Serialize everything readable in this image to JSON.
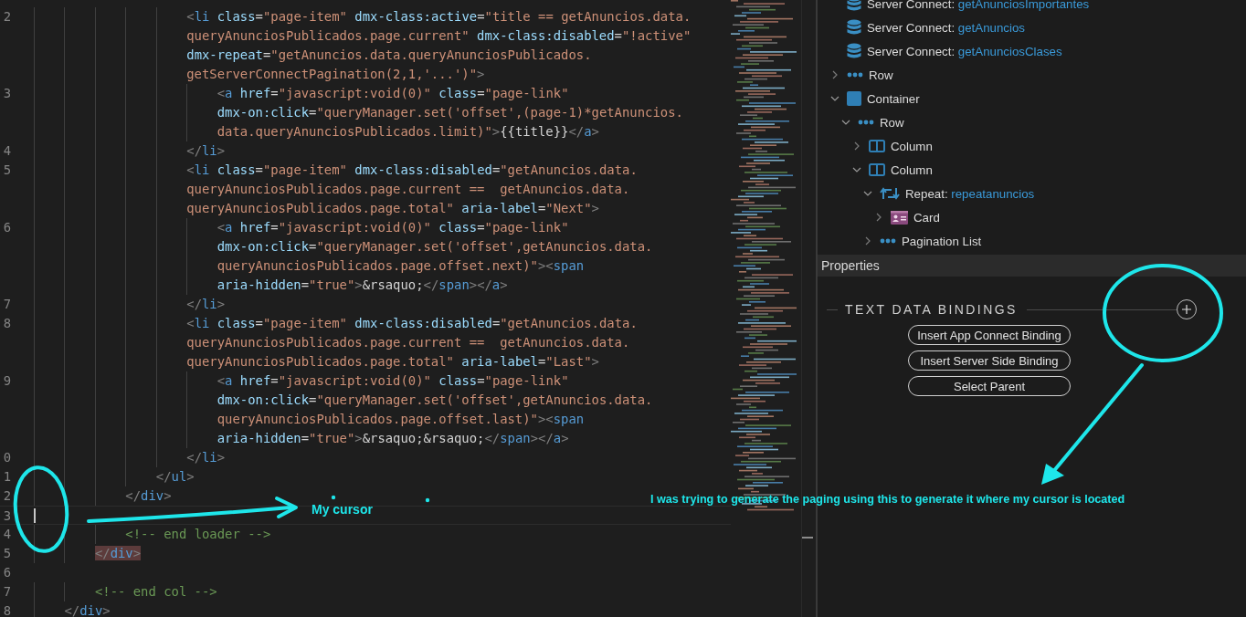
{
  "editor": {
    "rows": [
      {
        "n": "2",
        "kind": "code",
        "text": "                    <li class=\"page-item\" dmx-class:active=\"title == getAnuncios.data."
      },
      {
        "kind": "code",
        "text": "                    queryAnunciosPublicados.page.current\" dmx-class:disabled=\"!active\""
      },
      {
        "kind": "code",
        "text": "                    dmx-repeat=\"getAnuncios.data.queryAnunciosPublicados."
      },
      {
        "kind": "code",
        "text": "                    getServerConnectPagination(2,1,'...')\">"
      },
      {
        "n": "3",
        "kind": "code",
        "text": "                        <a href=\"javascript:void(0)\" class=\"page-link\""
      },
      {
        "kind": "code",
        "text": "                        dmx-on:click=\"queryManager.set('offset',(page-1)*getAnuncios."
      },
      {
        "kind": "code",
        "text": "                        data.queryAnunciosPublicados.limit)\">{{title}}</a>"
      },
      {
        "n": "4",
        "kind": "code",
        "text": "                    </li>"
      },
      {
        "n": "5",
        "kind": "code",
        "text": "                    <li class=\"page-item\" dmx-class:disabled=\"getAnuncios.data."
      },
      {
        "kind": "code",
        "text": "                    queryAnunciosPublicados.page.current ==  getAnuncios.data."
      },
      {
        "kind": "code",
        "text": "                    queryAnunciosPublicados.page.total\" aria-label=\"Next\">"
      },
      {
        "n": "6",
        "kind": "code",
        "text": "                        <a href=\"javascript:void(0)\" class=\"page-link\""
      },
      {
        "kind": "code",
        "text": "                        dmx-on:click=\"queryManager.set('offset',getAnuncios.data."
      },
      {
        "kind": "code",
        "text": "                        queryAnunciosPublicados.page.offset.next)\"><span"
      },
      {
        "kind": "code",
        "text": "                        aria-hidden=\"true\">&rsaquo;</span></a>"
      },
      {
        "n": "7",
        "kind": "code",
        "text": "                    </li>"
      },
      {
        "n": "8",
        "kind": "code",
        "text": "                    <li class=\"page-item\" dmx-class:disabled=\"getAnuncios.data."
      },
      {
        "kind": "code",
        "text": "                    queryAnunciosPublicados.page.current ==  getAnuncios.data."
      },
      {
        "kind": "code",
        "text": "                    queryAnunciosPublicados.page.total\" aria-label=\"Last\">"
      },
      {
        "n": "9",
        "kind": "code",
        "text": "                        <a href=\"javascript:void(0)\" class=\"page-link\""
      },
      {
        "kind": "code",
        "text": "                        dmx-on:click=\"queryManager.set('offset',getAnuncios.data."
      },
      {
        "kind": "code",
        "text": "                        queryAnunciosPublicados.page.offset.last)\"><span"
      },
      {
        "kind": "code",
        "text": "                        aria-hidden=\"true\">&rsaquo;&rsaquo;</span></a>"
      },
      {
        "n": "0",
        "kind": "code",
        "text": "                    </li>"
      },
      {
        "n": "1",
        "kind": "code",
        "text": "                </ul>"
      },
      {
        "n": "2",
        "kind": "code",
        "text": "            </div>"
      },
      {
        "n": "3",
        "kind": "cursor"
      },
      {
        "n": "4",
        "kind": "code",
        "text": "            <!-- end loader -->"
      },
      {
        "n": "5",
        "kind": "match",
        "text": "        </div>"
      },
      {
        "n": "6",
        "kind": "code"
      },
      {
        "n": "7",
        "kind": "code",
        "text": "        <!-- end col -->"
      },
      {
        "n": "8",
        "kind": "code",
        "text": "    </div>"
      }
    ]
  },
  "tree": [
    {
      "kind": "server",
      "label": "Server Connect:",
      "name": "getAnunciosImportantes"
    },
    {
      "kind": "server",
      "label": "Server Connect:",
      "name": "getAnuncios"
    },
    {
      "kind": "server",
      "label": "Server Connect:",
      "name": "getAnunciosClases"
    },
    {
      "kind": "row",
      "label": "Row",
      "expanded": false
    },
    {
      "kind": "container",
      "label": "Container",
      "expanded": true,
      "children": [
        {
          "kind": "row",
          "label": "Row",
          "expanded": true,
          "children": [
            {
              "kind": "column",
              "label": "Column",
              "expanded": false
            },
            {
              "kind": "column",
              "label": "Column",
              "expanded": true,
              "children": [
                {
                  "kind": "repeat",
                  "label": "Repeat:",
                  "name": "repeatanuncios",
                  "expanded": true,
                  "children": [
                    {
                      "kind": "card",
                      "label": "Card",
                      "expanded": false
                    }
                  ]
                },
                {
                  "kind": "row",
                  "label": "Pagination List",
                  "expanded": false
                }
              ]
            }
          ]
        }
      ]
    }
  ],
  "properties": {
    "title": "Properties",
    "section": "TEXT DATA BINDINGS",
    "buttons": [
      "Insert App Connect Binding",
      "Insert Server Side Binding",
      "Select Parent"
    ]
  },
  "annotations": {
    "cursor_note": "My cursor",
    "panel_note": "I was trying to generate the paging using this to generate it where my cursor is located"
  }
}
